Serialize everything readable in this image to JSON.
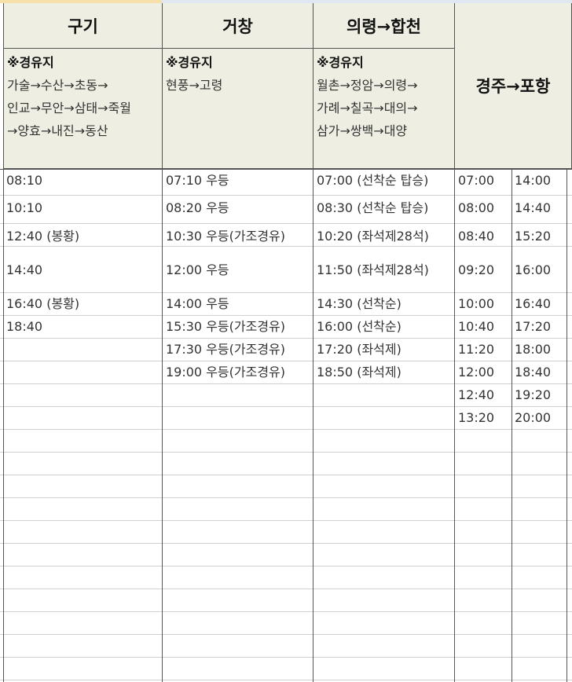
{
  "columns": [
    {
      "title": "구기",
      "via_label": "※경유지",
      "via": [
        "가술→수산→초동→",
        "인교→무안→삼태→죽월",
        "→양효→내진→동산"
      ],
      "times": [
        "08:10",
        "10:10",
        "12:40 (봉황)",
        "14:40",
        "16:40 (봉황)",
        "18:40"
      ]
    },
    {
      "title": "거창",
      "via_label": "※경유지",
      "via": [
        "현풍→고령"
      ],
      "times": [
        "07:10 우등",
        "08:20 우등",
        "10:30 우등(가조경유)",
        "12:00 우등",
        "14:00 우등",
        "15:30 우등(가조경유)",
        "17:30 우등(가조경유)",
        "19:00 우등(가조경유)"
      ]
    },
    {
      "title": "의령→합천",
      "via_label": "※경유지",
      "via": [
        "월촌→정암→의령→",
        "가례→칠곡→대의→",
        "삼가→쌍백→대양"
      ],
      "times": [
        "07:00 (선착순 탑승)",
        "08:30 (선착순 탑승)",
        "10:20 (좌석제28석)",
        "11:50 (좌석제28석)",
        "14:30 (선착순)",
        "16:00 (선착순)",
        "17:20 (좌석제)",
        "18:50 (좌석제)"
      ]
    },
    {
      "title": "경주→포항",
      "times_a": [
        "07:00",
        "08:00",
        "08:40",
        "09:20",
        "10:00",
        "10:40",
        "11:20",
        "12:00",
        "12:40",
        "13:20"
      ],
      "times_b": [
        "14:00",
        "14:40",
        "15:20",
        "16:00",
        "16:40",
        "17:20",
        "18:00",
        "18:40",
        "19:20",
        "20:00"
      ]
    }
  ]
}
